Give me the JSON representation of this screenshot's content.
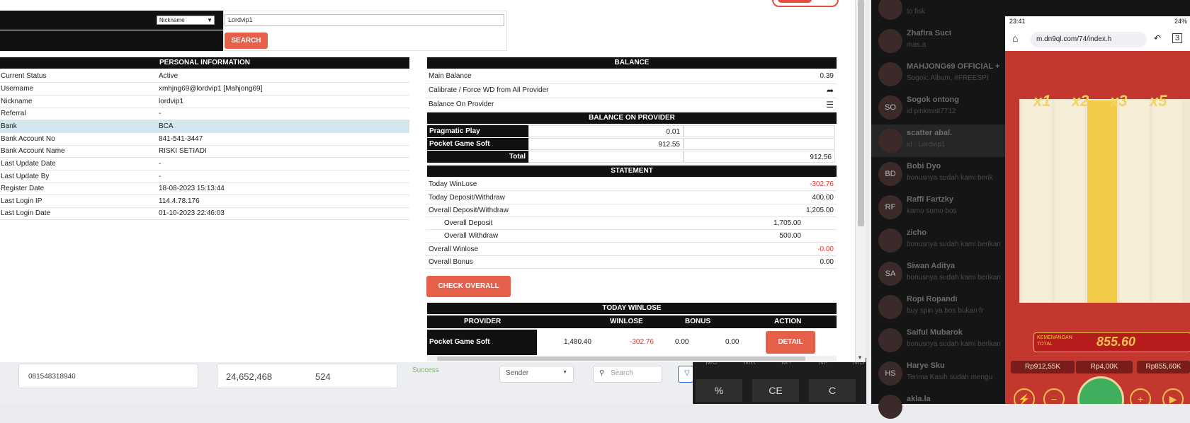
{
  "search": {
    "select_value": "Nickname",
    "input_value": "Lordvip1",
    "button_label": "SEARCH"
  },
  "personal": {
    "title": "PERSONAL INFORMATION",
    "rows": [
      {
        "k": "Current Status",
        "v": "Active"
      },
      {
        "k": "Username",
        "v": "xmhjng69@lordvip1  [Mahjong69]"
      },
      {
        "k": "Nickname",
        "v": "lordvip1"
      },
      {
        "k": "Referral",
        "v": "-"
      },
      {
        "k": "Bank",
        "v": "BCA"
      },
      {
        "k": "Bank Account No",
        "v": "841-541-3447"
      },
      {
        "k": "Bank Account Name",
        "v": "RISKI SETIADI"
      },
      {
        "k": "Last Update Date",
        "v": "-"
      },
      {
        "k": "Last Update By",
        "v": "-"
      },
      {
        "k": "Register Date",
        "v": "18-08-2023 15:13:44"
      },
      {
        "k": "Last Login IP",
        "v": "114.4.78.176"
      },
      {
        "k": "Last Login Date",
        "v": "01-10-2023 22:46:03"
      }
    ]
  },
  "balance": {
    "title": "BALANCE",
    "main_balance_label": "Main Balance",
    "main_balance_value": "0.39",
    "calibrate_label": "Calibrate / Force WD from All Provider",
    "balance_on_provider_label": "Balance On Provider",
    "provider_title": "BALANCE ON PROVIDER",
    "providers": [
      {
        "name": "Pragmatic Play",
        "value": "0.01",
        "extra": ""
      },
      {
        "name": "Pocket Game Soft",
        "value": "912.55",
        "extra": ""
      }
    ],
    "total_label": "Total",
    "total_value": "912.56"
  },
  "statement": {
    "title": "STATEMENT",
    "rows": [
      {
        "k": "Today WinLose",
        "v": "-302.76",
        "red": true
      },
      {
        "k": "Today Deposit/Withdraw",
        "v": "400.00"
      },
      {
        "k": "Overall Deposit/Withdraw",
        "v": "1,205.00"
      },
      {
        "k": "Overall Deposit",
        "v": "1,705.00",
        "sub": true
      },
      {
        "k": "Overall Withdraw",
        "v": "500.00",
        "sub": true
      },
      {
        "k": "Overall Winlose",
        "v": "-0.00",
        "red": true
      },
      {
        "k": "Overall Bonus",
        "v": "0.00"
      }
    ],
    "check_button": "CHECK OVERALL"
  },
  "today_winlose": {
    "title": "TODAY WINLOSE",
    "headers": [
      "PROVIDER",
      "WINLOSE",
      "BONUS",
      "ACTION"
    ],
    "row": {
      "provider": "Pocket Game Soft",
      "turnover": "1,480.40",
      "winlose": "-302.76",
      "bonus": "0.00",
      "extra": "0.00",
      "action": "DETAIL"
    }
  },
  "background": {
    "phone_number": "081548318940",
    "amount": "24,652,468",
    "count": "524",
    "success_text": "Success",
    "sender_label": "Sender",
    "search_placeholder": "Search"
  },
  "calculator": {
    "memory_keys": [
      "MC",
      "MR",
      "M+",
      "M-",
      "MS"
    ],
    "keys": [
      "%",
      "CE",
      "C"
    ]
  },
  "chat": {
    "items": [
      {
        "initials": "",
        "name": "",
        "msg": "to fisk"
      },
      {
        "initials": "",
        "name": "Zhafira Suci",
        "msg": "mas.a"
      },
      {
        "initials": "",
        "name": "MAHJONG69 OFFICIAL +",
        "msg": "Sogok: Album, #FREESPI"
      },
      {
        "initials": "SO",
        "name": "Sogok ontong",
        "msg": "id pinkmist7712"
      },
      {
        "initials": "",
        "name": "scatter abal.",
        "msg": "id : Lordvip1"
      },
      {
        "initials": "BD",
        "name": "Bobi Dyo",
        "msg": "bonusnya sudah kami berik"
      },
      {
        "initials": "RF",
        "name": "Raffi Fartzky",
        "msg": "kamo somo bos"
      },
      {
        "initials": "",
        "name": "zicho",
        "msg": "bonusnya sudah kami berikan"
      },
      {
        "initials": "SA",
        "name": "Siwan Aditya",
        "msg": "bonusnya sudah kami berikan"
      },
      {
        "initials": "",
        "name": "Ropi Ropandi",
        "msg": "buy spin ya bos bukan fr"
      },
      {
        "initials": "",
        "name": "Saiful Mubarok",
        "msg": "bonusnya sudah kami berikan"
      },
      {
        "initials": "HS",
        "name": "Harye Sku",
        "msg": "Terima Kasih sudah mengu"
      },
      {
        "initials": "",
        "name": "akla.la",
        "msg": ""
      }
    ]
  },
  "phone": {
    "time": "23:41",
    "battery": "24%",
    "url": "m.dn9ql.com/74/index.h",
    "multipliers": [
      "x1",
      "x2",
      "x3",
      "x5"
    ],
    "win_label": "KEMENANGAN TOTAL",
    "win_value": "855.60",
    "balances": [
      "Rp912,55K",
      "Rp4,00K",
      "Rp855,60K"
    ],
    "turbo": "TURBO",
    "auto": "AUTO"
  }
}
